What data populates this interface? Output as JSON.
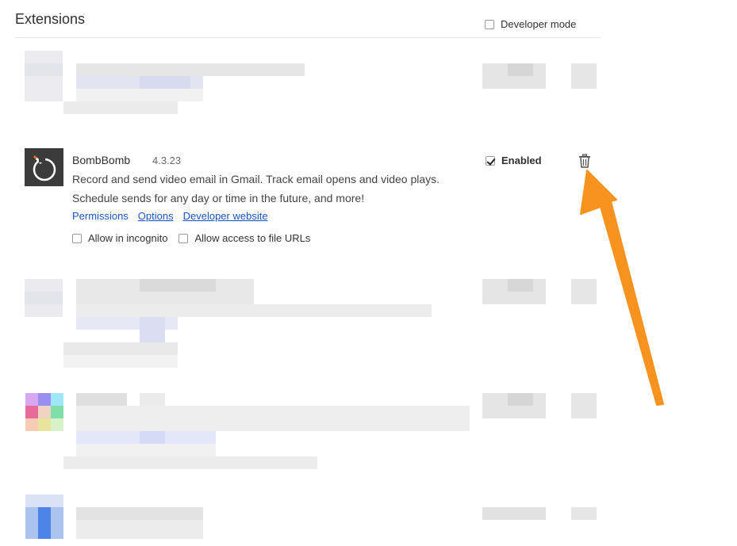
{
  "header": {
    "title": "Extensions",
    "developer_mode_label": "Developer mode"
  },
  "extension": {
    "name": "BombBomb",
    "version": "4.3.23",
    "description": "Record and send video email in Gmail. Track email opens and video plays. Schedule sends for any day or time in the future, and more!",
    "links": {
      "permissions": "Permissions",
      "options": "Options",
      "developer_website": "Developer website"
    },
    "allow_incognito_label": "Allow in incognito",
    "allow_file_urls_label": "Allow access to file URLs",
    "enabled_label": "Enabled",
    "enabled": true
  },
  "icons": {
    "trash": "trash-icon",
    "extension_icon": "bombbomb-logo-icon",
    "annotation": "orange-arrow-icon"
  },
  "colors": {
    "link": "#1a54c9",
    "arrow": "#f7931e",
    "icon_bg": "#3b3b3b"
  }
}
